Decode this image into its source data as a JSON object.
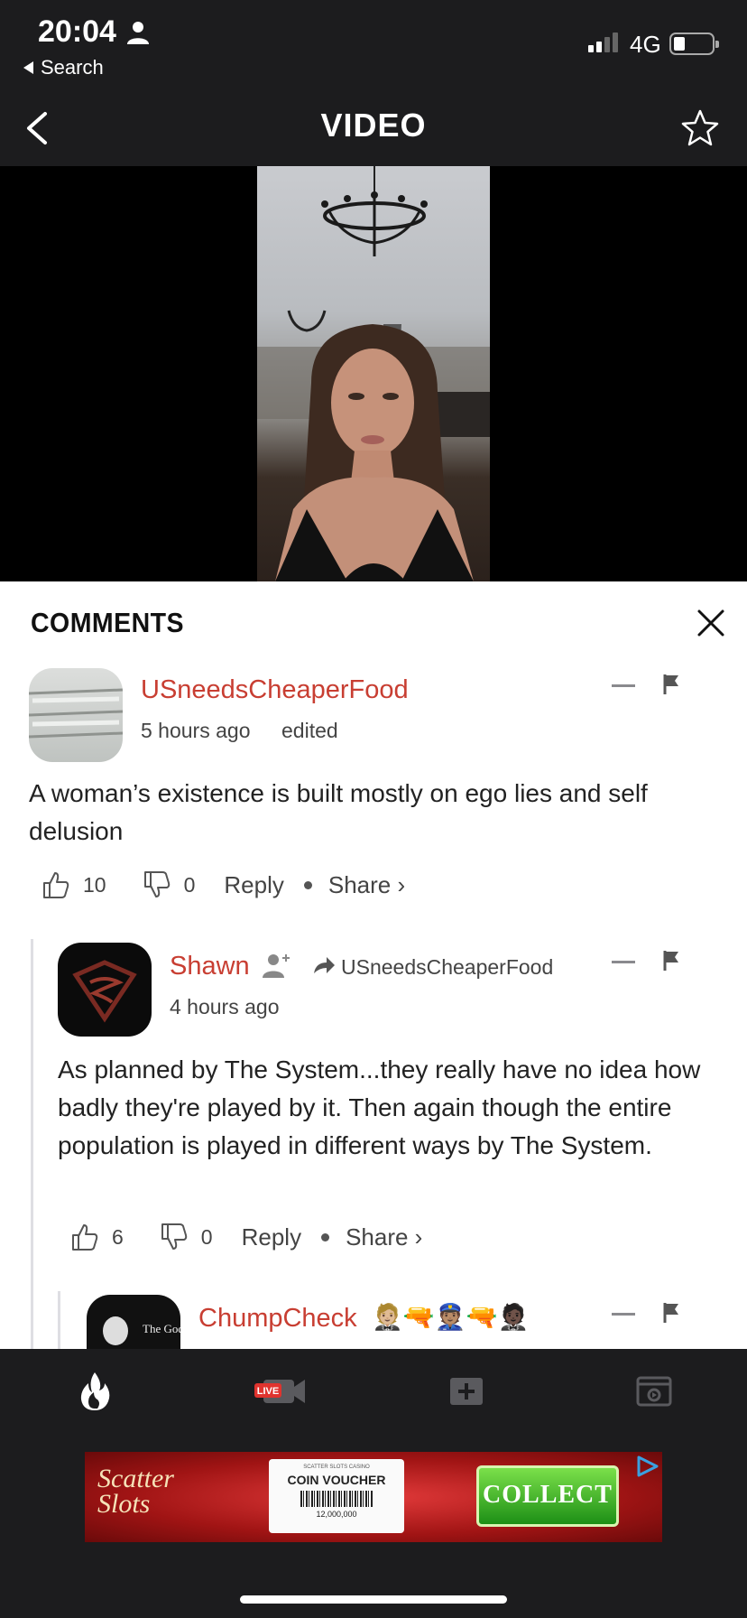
{
  "status_bar": {
    "time": "20:04",
    "back_app_label": "Search",
    "network": "4G",
    "battery_level": 0.3
  },
  "nav": {
    "title": "VIDEO",
    "back_icon": "chevron-left-icon",
    "favorite_icon": "star-outline-icon"
  },
  "comments": {
    "title": "COMMENTS",
    "items": [
      {
        "username": "USneedsCheaperFood",
        "time": "5 hours ago",
        "edited": "edited",
        "text": "A woman’s existence is built mostly on ego lies and self delusion",
        "likes": "10",
        "dislikes": "0",
        "reply_label": "Reply",
        "share_label": "Share ›"
      },
      {
        "username": "Shawn",
        "reply_to": "USneedsCheaperFood",
        "time": "4 hours ago",
        "text": "As planned by The System...they really have no idea how badly they're played by it. Then again though the entire population is played in different ways by The System.",
        "likes": "6",
        "dislikes": "0",
        "reply_label": "Reply",
        "share_label": "Share ›"
      },
      {
        "username": "ChumpCheck",
        "emojis": "🤵🏼🔫👮🏽🔫🤵🏿",
        "avatar_text": "The Godfather"
      }
    ]
  },
  "tabbar": {
    "tabs": [
      {
        "icon": "flame-icon",
        "active": true
      },
      {
        "icon": "live-camera-icon",
        "badge": "LIVE"
      },
      {
        "icon": "add-icon"
      },
      {
        "icon": "video-library-icon"
      }
    ]
  },
  "ad": {
    "brand": "Scatter Slots",
    "voucher_small": "SCATTER SLOTS CASINO",
    "voucher_title": "COIN VOUCHER",
    "voucher_amount": "12,000,000",
    "cta": "COLLECT"
  }
}
